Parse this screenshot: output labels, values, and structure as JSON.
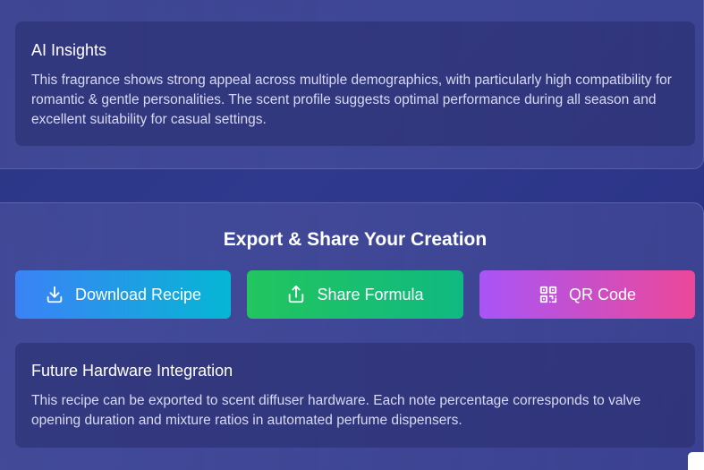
{
  "insights": {
    "title": "AI Insights",
    "body": "This fragrance shows strong appeal across multiple demographics, with particularly high compatibility for romantic & gentle personalities. The scent profile suggests optimal performance during all season and excellent suitability for casual settings."
  },
  "export": {
    "heading": "Export & Share Your Creation",
    "buttons": {
      "download": {
        "label": "Download Recipe",
        "icon": "download-icon"
      },
      "share": {
        "label": "Share Formula",
        "icon": "share-icon"
      },
      "qr": {
        "label": "QR Code",
        "icon": "qr-code-icon"
      }
    }
  },
  "hardware": {
    "title": "Future Hardware Integration",
    "body": "This recipe can be exported to scent diffuser hardware. Each note percentage corresponds to valve opening duration and mixture ratios in automated perfume dispensers."
  },
  "colors": {
    "download_gradient": [
      "#3b82f6",
      "#06b6d4"
    ],
    "share_gradient": [
      "#22c55e",
      "#10b981"
    ],
    "qr_gradient": [
      "#a855f7",
      "#ec4899"
    ]
  }
}
